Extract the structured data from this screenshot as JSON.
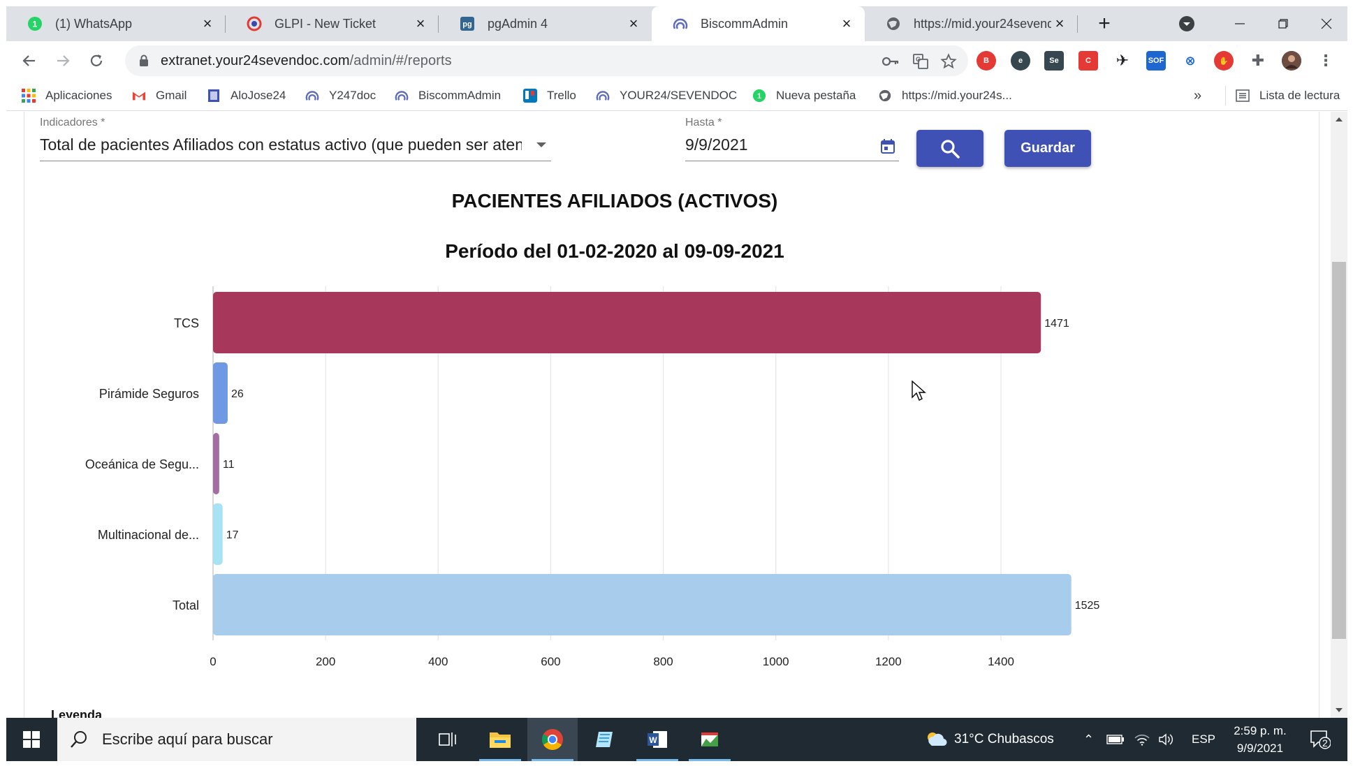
{
  "browser": {
    "tabs": [
      {
        "title": "(1) WhatsApp",
        "active": false
      },
      {
        "title": "GLPI - New Ticket",
        "active": false
      },
      {
        "title": "pgAdmin 4",
        "active": false
      },
      {
        "title": "BiscommAdmin",
        "active": true
      },
      {
        "title": "https://mid.your24sevend",
        "active": false
      }
    ],
    "url_host": "extranet.your24sevendoc.com",
    "url_path": "/admin/#/reports",
    "bookmarks": [
      {
        "label": "Aplicaciones"
      },
      {
        "label": "Gmail"
      },
      {
        "label": "AloJose24"
      },
      {
        "label": "Y247doc"
      },
      {
        "label": "BiscommAdmin"
      },
      {
        "label": "Trello"
      },
      {
        "label": "YOUR24/SEVENDOC"
      },
      {
        "label": "Nueva pestaña"
      },
      {
        "label": "https://mid.your24s..."
      }
    ],
    "bookmarks_overflow": "»",
    "reading_list": "Lista de lectura"
  },
  "form": {
    "indicator_label": "Indicadores *",
    "indicator_value": "Total de pacientes Afiliados con estatus activo (que pueden ser atendidos dado ...",
    "until_label": "Hasta *",
    "until_value": "9/9/2021",
    "save_label": "Guardar"
  },
  "chart_data": {
    "type": "bar",
    "orientation": "horizontal",
    "title": "PACIENTES AFILIADOS (ACTIVOS)",
    "subtitle": "Período del 01-02-2020 al 09-09-2021",
    "categories": [
      "TCS",
      "Pirámide Seguros",
      "Oceánica de Segu...",
      "Multinacional de...",
      "Total"
    ],
    "values": [
      1471,
      26,
      11,
      17,
      1525
    ],
    "value_labels": [
      "1471",
      "26",
      "11",
      "17",
      "1525"
    ],
    "colors": [
      "#a7385c",
      "#6f9ae3",
      "#a36fa3",
      "#a8e2f5",
      "#a8ccec"
    ],
    "xlim": [
      0,
      1525
    ],
    "xticks": [
      0,
      200,
      400,
      600,
      800,
      1000,
      1200,
      1400
    ],
    "xtick_labels": [
      "0",
      "200",
      "400",
      "600",
      "800",
      "1000",
      "1200",
      "1400"
    ],
    "grid": true
  },
  "legend_heading": "Leyenda",
  "taskbar": {
    "search_placeholder": "Escribe aquí para buscar",
    "weather": "31°C  Chubascos",
    "language": "ESP",
    "time": "2:59 p. m.",
    "date": "9/9/2021",
    "notifications": "2"
  }
}
